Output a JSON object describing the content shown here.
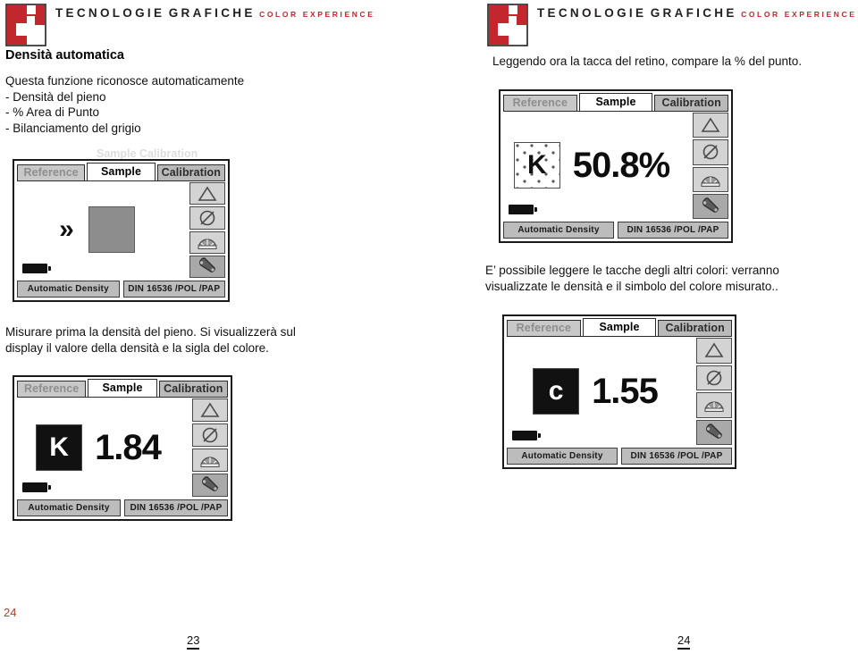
{
  "brand": {
    "line1": "TECNOLOGIE",
    "line2": "GRAFICHE",
    "line3": "COLOR EXPERIENCE",
    "mark_color": "#c1272d",
    "text_color": "#231f20"
  },
  "left_column": {
    "heading": "Densità automatica",
    "intro": {
      "l1": "Questa funzione riconosce automaticamente",
      "l2": "- Densità del pieno",
      "l3": "- % Area di Punto",
      "l4": "- Bilanciamento del grigio"
    },
    "ghost_text": "Sample      Calibration",
    "caption": {
      "l1": "Misurare prima la densità del pieno. Si visualizzerà sul",
      "l2": "display il valore della densità e la sigla del colore."
    }
  },
  "right_column": {
    "caption_top": "Leggendo ora la tacca del retino, compare la % del punto.",
    "caption_mid": {
      "l1": "E’ possibile leggere le tacche degli altri colori: verranno",
      "l2": "visualizzate le densità e il simbolo del colore misurato.."
    }
  },
  "device": {
    "tabs": {
      "reference": "Reference",
      "sample": "Sample",
      "calibration": "Calibration"
    },
    "side_buttons": [
      {
        "name": "delta-triangle-icon",
        "label": "Delta"
      },
      {
        "name": "diameter-slash-icon",
        "label": "Null"
      },
      {
        "name": "color-fan-icon",
        "label": "Palette"
      },
      {
        "name": "wrench-icon",
        "label": "Settings"
      }
    ],
    "footer": {
      "mode": "Automatic Density",
      "standard": "DIN 16536 /POL /PAP"
    }
  },
  "screens": [
    {
      "id": "screen-measure-prompt",
      "swatch_style": "solid-gray",
      "swatch_label": "",
      "reading": "",
      "chevron": "»"
    },
    {
      "id": "screen-dot-area",
      "swatch_style": "screened",
      "swatch_label": "K",
      "reading": "50.8%",
      "chevron": ""
    },
    {
      "id": "screen-solid-density",
      "swatch_style": "black",
      "swatch_label": "K",
      "reading": "1.84",
      "chevron": ""
    },
    {
      "id": "screen-cyan-density",
      "swatch_style": "black",
      "swatch_label": "c",
      "reading": "1.55",
      "chevron": ""
    }
  ],
  "footer": {
    "marker_red": "24",
    "page_left": "23",
    "page_right": "24"
  }
}
